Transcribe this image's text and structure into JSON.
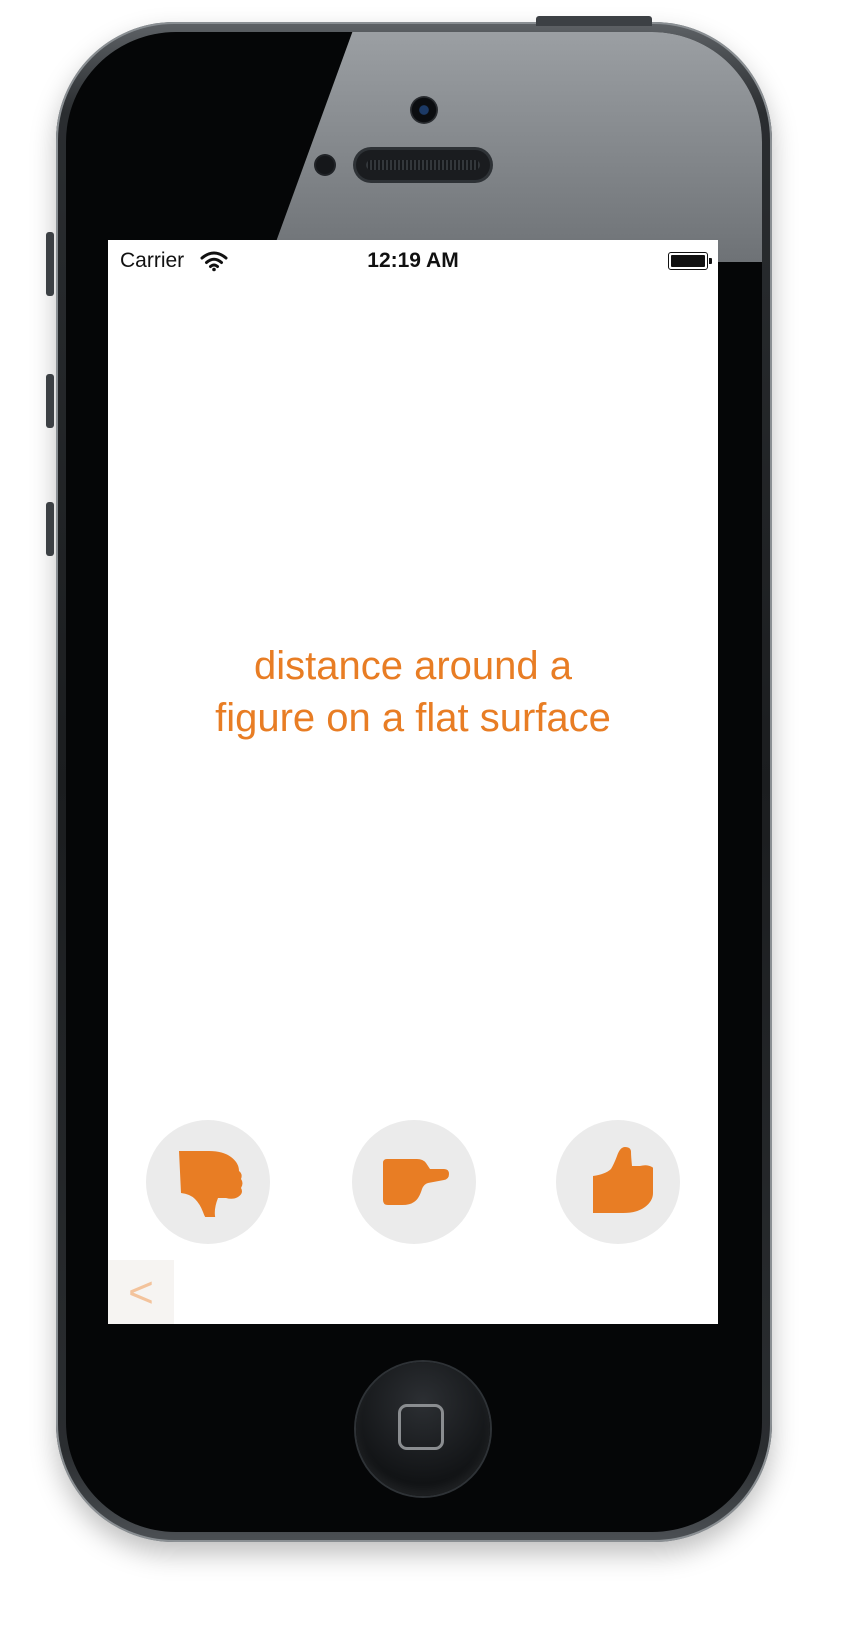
{
  "status_bar": {
    "carrier": "Carrier",
    "time": "12:19 AM",
    "wifi_icon": "wifi-icon",
    "battery_icon": "battery-full-icon",
    "battery_level": 1.0
  },
  "card": {
    "text": "distance around a\nfigure on a flat surface"
  },
  "rating_buttons": [
    {
      "name": "thumbs-down",
      "icon": "thumbs-down-icon"
    },
    {
      "name": "thumbs-sideways",
      "icon": "thumbs-sideways-icon"
    },
    {
      "name": "thumbs-up",
      "icon": "thumbs-up-icon"
    }
  ],
  "back_button": {
    "label": "<"
  },
  "colors": {
    "accent": "#e87d24",
    "button_bg": "#ebebeb",
    "back_arrow": "#f3c39c"
  }
}
